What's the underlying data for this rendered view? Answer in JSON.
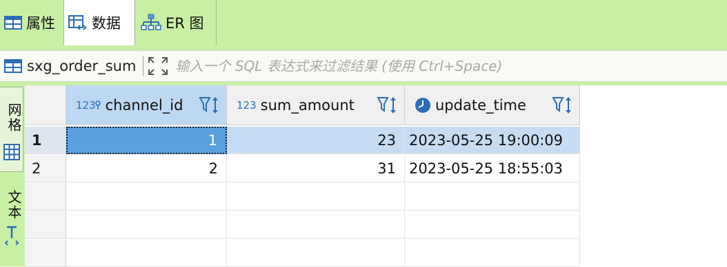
{
  "tabs": [
    {
      "label": "属性",
      "icon": "table-icon"
    },
    {
      "label": "数据",
      "icon": "data-grid-icon"
    },
    {
      "label": "ER 图",
      "icon": "er-diagram-icon"
    }
  ],
  "filter": {
    "table_name": "sxg_order_sum",
    "placeholder": "输入一个 SQL 表达式来过滤结果 (使用 Ctrl+Space)"
  },
  "side_panel": {
    "grid_label": "网格",
    "text_label": "文本"
  },
  "columns": [
    {
      "type_icon": "123",
      "name": "channel_id"
    },
    {
      "type_icon": "123",
      "name": "sum_amount"
    },
    {
      "type_icon": "clock-icon",
      "name": "update_time"
    }
  ],
  "rows": [
    {
      "num": "1",
      "cells": [
        "1",
        "23",
        "2023-05-25 19:00:09"
      ]
    },
    {
      "num": "2",
      "cells": [
        "2",
        "31",
        "2023-05-25 18:55:03"
      ]
    }
  ],
  "colors": {
    "tabbar_bg": "#c8f0a4",
    "selected_row": "#c6dcf2",
    "focused_cell": "#5a9fde",
    "accent_blue": "#1f6fc4"
  }
}
